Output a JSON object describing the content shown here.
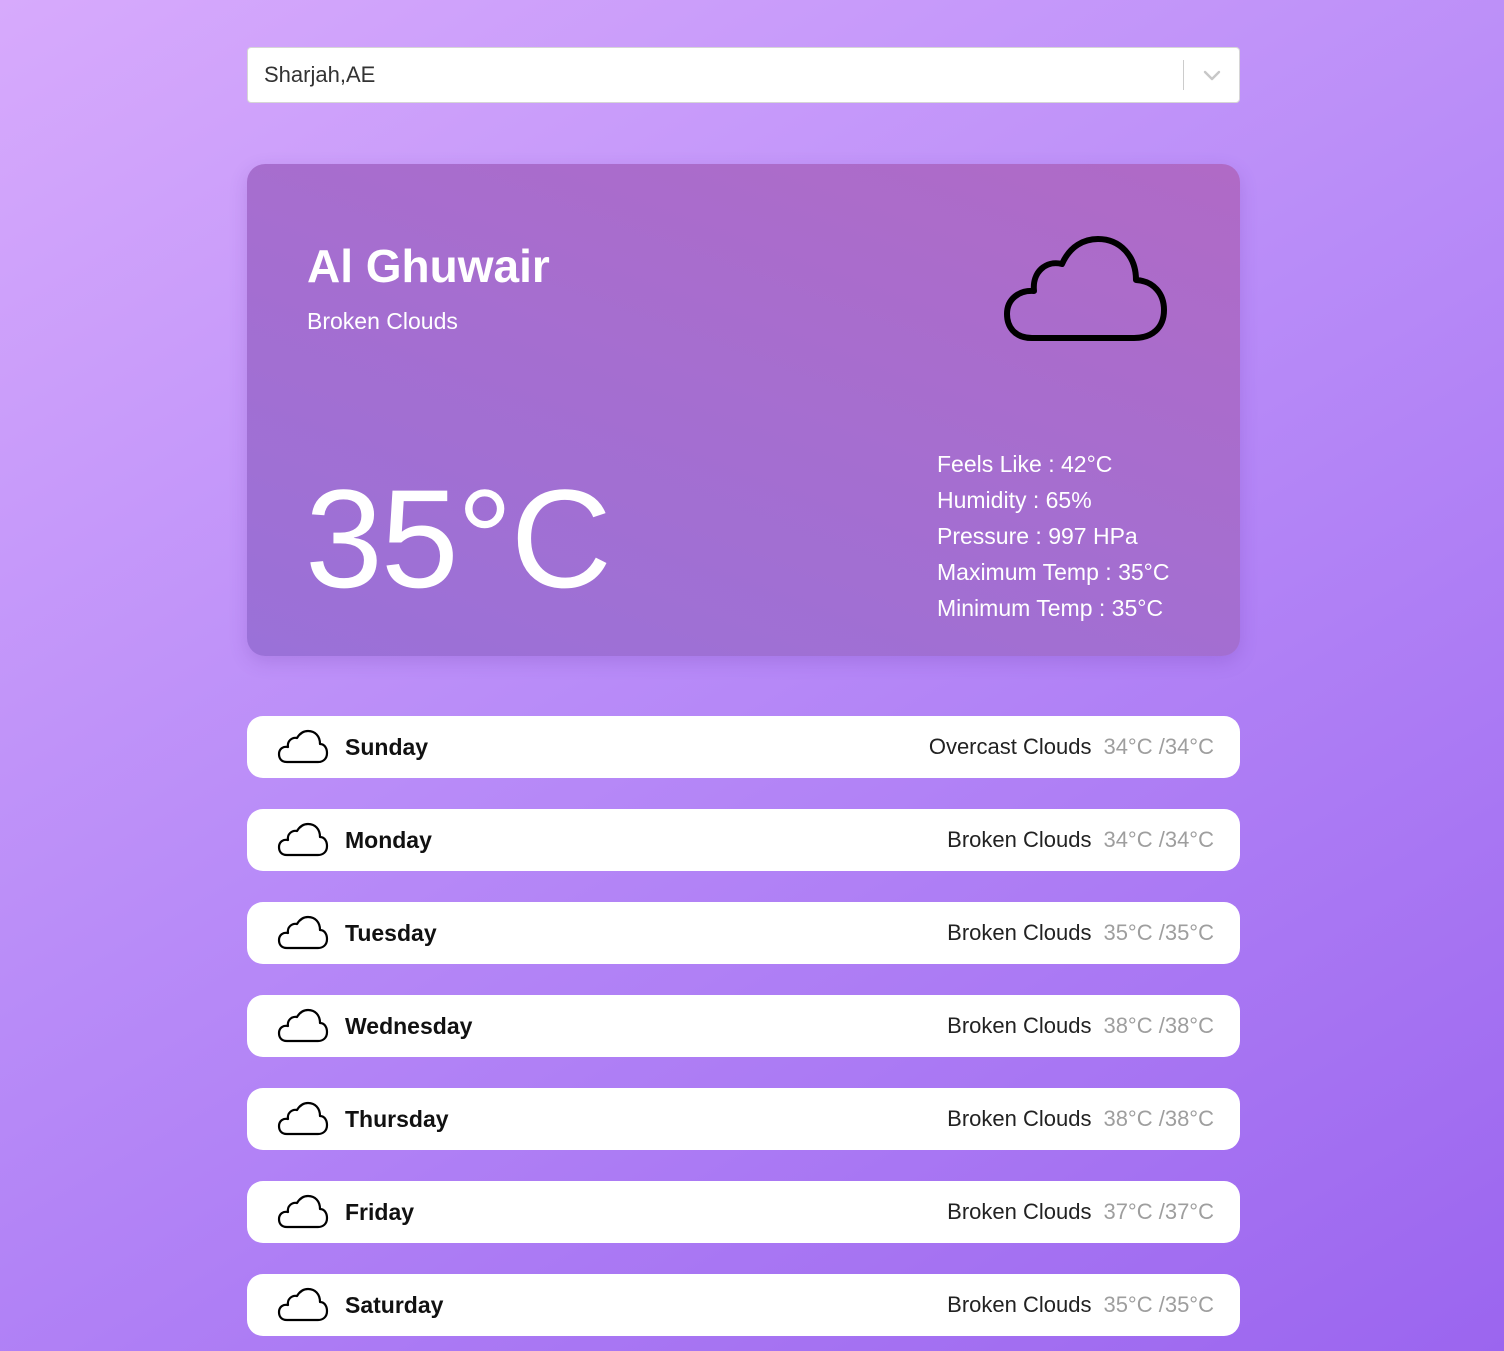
{
  "search": {
    "value": "Sharjah,AE",
    "chevron_icon": "chevron-down-icon"
  },
  "current": {
    "city": "Al Ghuwair",
    "description": "Broken Clouds",
    "temperature": "35°C",
    "icon": "cloud-icon",
    "details": [
      {
        "label": "Feels Like",
        "value": "42°C"
      },
      {
        "label": "Humidity",
        "value": "65%"
      },
      {
        "label": "Pressure",
        "value": "997 HPa"
      },
      {
        "label": "Maximum Temp",
        "value": "35°C"
      },
      {
        "label": "Minimum Temp",
        "value": "35°C"
      }
    ]
  },
  "forecast": [
    {
      "day": "Sunday",
      "description": "Overcast Clouds",
      "range": "34°C /34°C",
      "icon": "cloud-icon"
    },
    {
      "day": "Monday",
      "description": "Broken Clouds",
      "range": "34°C /34°C",
      "icon": "cloud-icon"
    },
    {
      "day": "Tuesday",
      "description": "Broken Clouds",
      "range": "35°C /35°C",
      "icon": "cloud-icon"
    },
    {
      "day": "Wednesday",
      "description": "Broken Clouds",
      "range": "38°C /38°C",
      "icon": "cloud-icon"
    },
    {
      "day": "Thursday",
      "description": "Broken Clouds",
      "range": "38°C /38°C",
      "icon": "cloud-icon"
    },
    {
      "day": "Friday",
      "description": "Broken Clouds",
      "range": "37°C /37°C",
      "icon": "cloud-icon"
    },
    {
      "day": "Saturday",
      "description": "Broken Clouds",
      "range": "35°C /35°C",
      "icon": "cloud-icon"
    }
  ]
}
